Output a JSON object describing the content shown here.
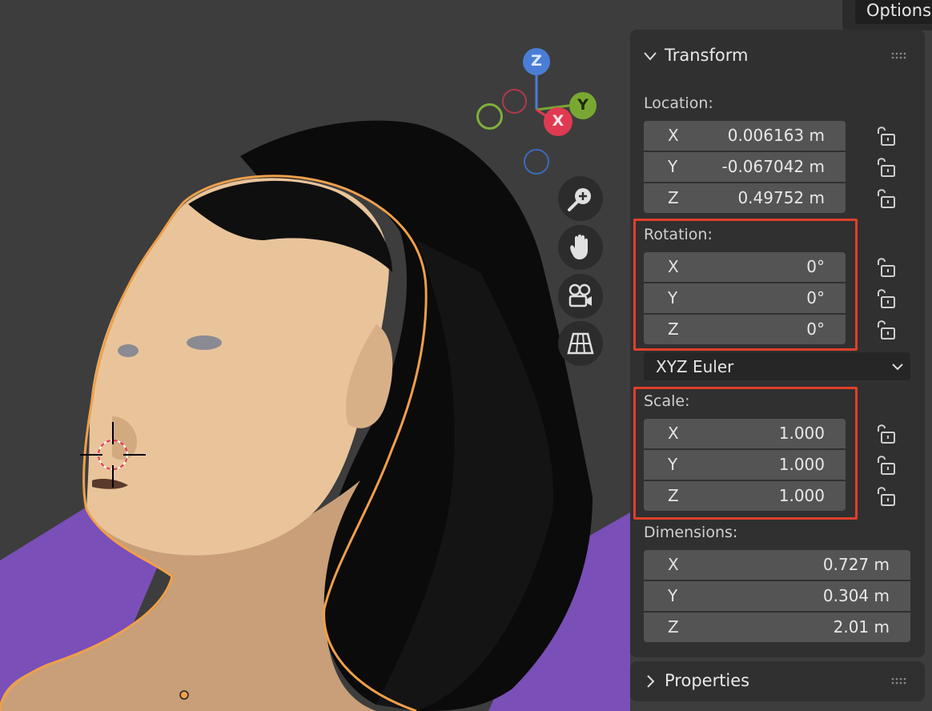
{
  "options_label": "Options",
  "gizmo": {
    "z_label": "Z",
    "y_label": "Y",
    "x_label": "X",
    "accent_colors": {
      "z": "#4a7ed6",
      "y": "#79a832",
      "x": "#e03a52",
      "selection_outline": "#f0a04a",
      "highlight_box": "#e0402a",
      "ground": "#7a4fb8"
    }
  },
  "viewport_tools": {
    "zoom": "zoom-in-icon",
    "pan": "hand-pan-icon",
    "camera": "camera-icon",
    "grid": "perspective-grid-icon"
  },
  "transform_panel": {
    "title": "Transform",
    "location": {
      "label": "Location:",
      "x_label": "X",
      "x_value": "0.006163 m",
      "y_label": "Y",
      "y_value": "-0.067042 m",
      "z_label": "Z",
      "z_value": "0.49752 m"
    },
    "rotation": {
      "label": "Rotation:",
      "x_label": "X",
      "x_value": "0°",
      "y_label": "Y",
      "y_value": "0°",
      "z_label": "Z",
      "z_value": "0°"
    },
    "rotation_mode": "XYZ Euler",
    "scale": {
      "label": "Scale:",
      "x_label": "X",
      "x_value": "1.000",
      "y_label": "Y",
      "y_value": "1.000",
      "z_label": "Z",
      "z_value": "1.000"
    },
    "dimensions": {
      "label": "Dimensions:",
      "x_label": "X",
      "x_value": "0.727 m",
      "y_label": "Y",
      "y_value": "0.304 m",
      "z_label": "Z",
      "z_value": "2.01 m"
    }
  },
  "properties_panel": {
    "title": "Properties"
  }
}
